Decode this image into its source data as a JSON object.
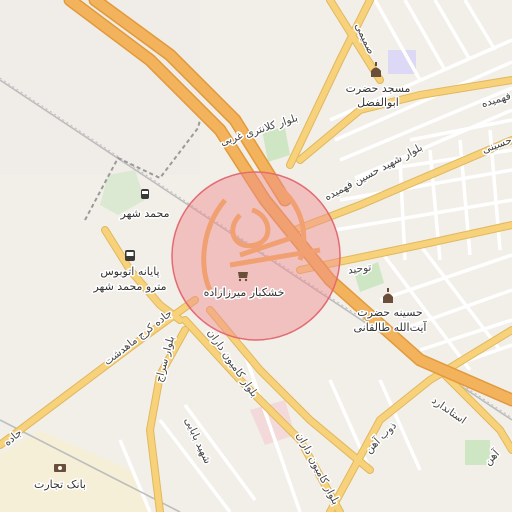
{
  "map": {
    "colors": {
      "background": "#f2efe9",
      "motorway": "#f3b25c",
      "motorway_casing": "#e19a3c",
      "primary": "#f7d27a",
      "primary_casing": "#e0b85f",
      "minor": "#ffffff",
      "park": "#cfe6c4",
      "pink_area": "#f3d9d9",
      "rail": "#b8b8b8",
      "highlight_fill": "#f08a8f",
      "highlight_stroke": "#e36b72",
      "lavender": "#dcd8f5"
    },
    "highlight": {
      "shape": "circle",
      "color": "#f08a8f",
      "opacity": 0.5
    },
    "pois": [
      {
        "name": "مسجد حضرت ابوالفضل",
        "line1": "مسجد حضرت",
        "line2": "ابوالفضل",
        "icon": "mosque-icon"
      },
      {
        "name": "محمد شهر",
        "line1": "محمد شهر",
        "line2": "",
        "icon": "train-station-icon"
      },
      {
        "name": "پایانه اتوبوس مترو محمد شهر",
        "line1": "پایانه اتوبوس",
        "line2": "مترو محمد شهر",
        "icon": "bus-icon"
      },
      {
        "name": "خشکبار میرزازاده",
        "line1": "خشکبار میرزازاده",
        "line2": "",
        "icon": "shop-icon"
      },
      {
        "name": "حسینه حضرت آیت‌الله طالقانی",
        "line1": "حسینه حضرت",
        "line2": "آیت‌الله طالقانی",
        "icon": "mosque-icon"
      },
      {
        "name": "بانک تجارت",
        "line1": "بانک تجارت",
        "line2": "",
        "icon": "bank-icon"
      }
    ],
    "roads": {
      "samimi": "صمیمی",
      "fahmideh": "فهمیده",
      "hosseini": "حسینی",
      "kalantari_gharbi": "بلوار کلانتری غربی",
      "shahid_hossein_fahmideh": "بلوار شهید حسین فهمیده",
      "tohid": "توحید",
      "jadeh_karaj_mahdasht": "جاده کرج ماهدشت",
      "bolvar_saraj": "بلوار سراج",
      "bolvar_camion_daran_1": "بلوار کامیون داران",
      "bolvar_camion_daran_2": "بلوار کامیون داران",
      "shahid_babaei": "شهید بابایی",
      "zob_ahan": "ذوب آهن",
      "estandard": "استاندارد",
      "ahan_right": "آهن",
      "jadeh_left": "جاده"
    }
  }
}
